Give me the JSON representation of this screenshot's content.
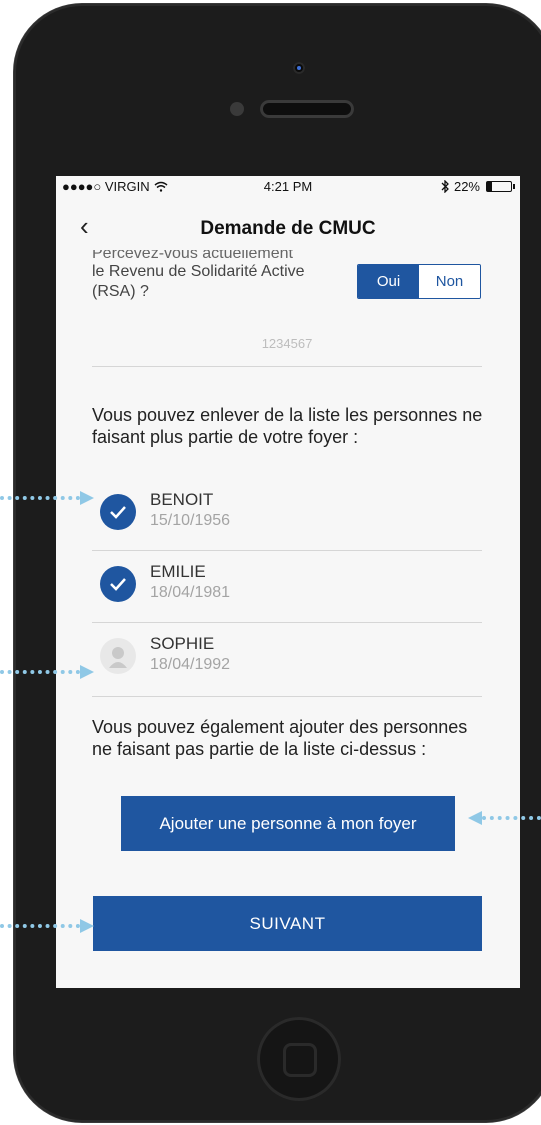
{
  "status_bar": {
    "carrier": "●●●●○ VIRGIN",
    "time": "4:21 PM",
    "battery": "22%"
  },
  "nav": {
    "title": "Demande de CMUC",
    "back_label": "<"
  },
  "rsa_question": {
    "clipped_line": "Percevez-vous actuellement",
    "line2": "le Revenu de Solidarité Active",
    "line3": "(RSA) ?",
    "options": {
      "yes": "Oui",
      "no": "Non"
    },
    "selected": "Oui"
  },
  "rsa_number_placeholder": "1234567",
  "remove_text": "Vous pouvez enlever de la liste les personnes ne faisant plus partie de votre foyer :",
  "persons": [
    {
      "name": "BENOIT",
      "date": "15/10/1956",
      "checked": true
    },
    {
      "name": "EMILIE",
      "date": "18/04/1981",
      "checked": true
    },
    {
      "name": "SOPHIE",
      "date": "18/04/1992",
      "checked": false
    }
  ],
  "add_text": "Vous pouvez également ajouter des personnes ne faisant pas partie de la liste ci-dessus :",
  "add_button": "Ajouter une personne à mon foyer",
  "next_button": "SUIVANT",
  "colors": {
    "primary": "#1f56a0",
    "arrow": "#8fc8e6"
  }
}
